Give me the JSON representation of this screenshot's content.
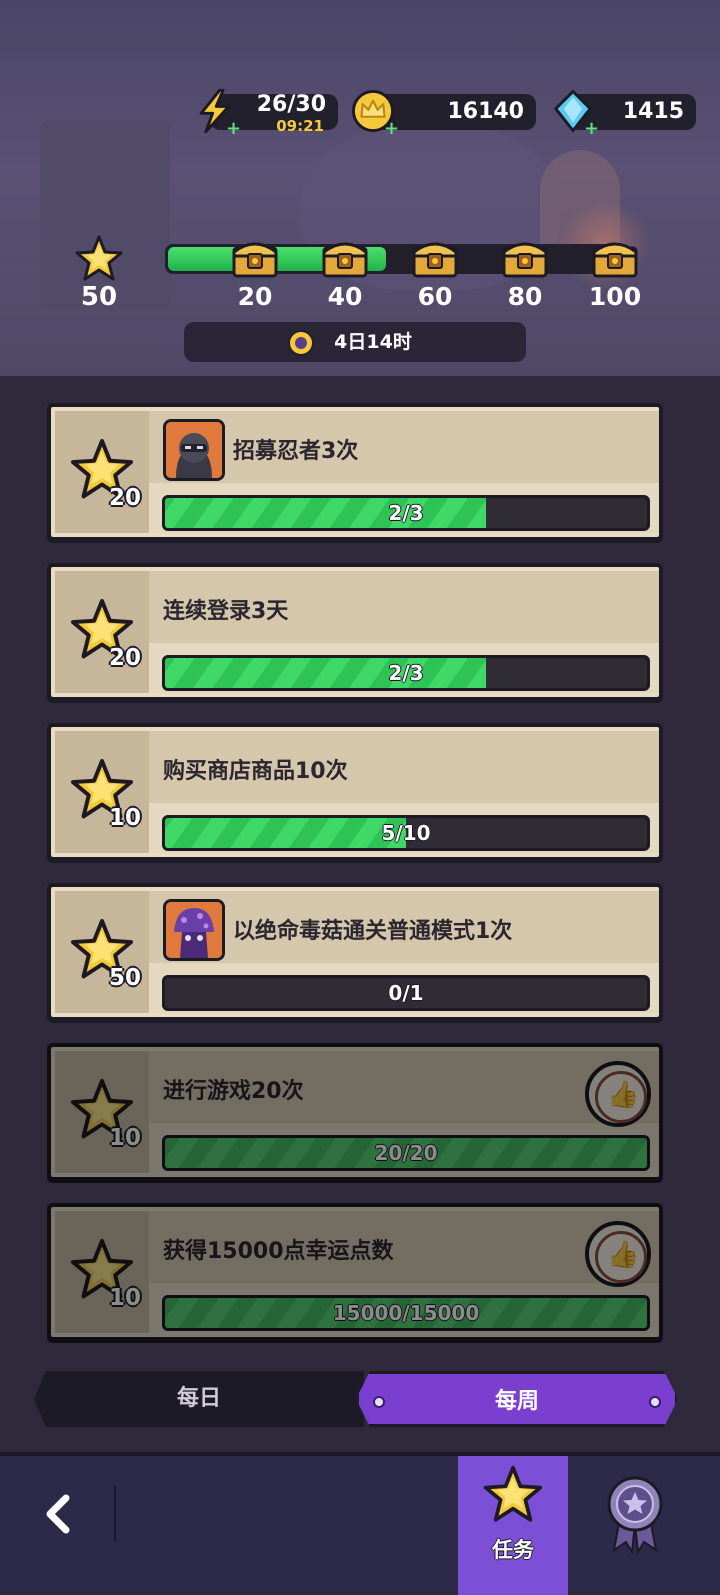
{
  "resources": {
    "energy": {
      "value": "26/30",
      "timer": "09:21"
    },
    "gold": {
      "value": "16140"
    },
    "gems": {
      "value": "1415"
    }
  },
  "progress": {
    "star_total": "50",
    "milestones": [
      "20",
      "40",
      "60",
      "80",
      "100"
    ],
    "fill_fraction": 0.49
  },
  "timer": {
    "label": "4日14时"
  },
  "tasks": [
    {
      "title": "招募忍者3次",
      "reward": "20",
      "progress": "2/3",
      "fraction": 0.667,
      "avatar": "ninja-avatar",
      "done": false
    },
    {
      "title": "连续登录3天",
      "reward": "20",
      "progress": "2/3",
      "fraction": 0.667,
      "avatar": "",
      "done": false
    },
    {
      "title": "购买商店商品10次",
      "reward": "10",
      "progress": "5/10",
      "fraction": 0.5,
      "avatar": "",
      "done": false
    },
    {
      "title": "以绝命毒菇通关普通模式1次",
      "reward": "50",
      "progress": "0/1",
      "fraction": 0,
      "avatar": "mushroom-avatar",
      "done": false
    },
    {
      "title": "进行游戏20次",
      "reward": "10",
      "progress": "20/20",
      "fraction": 1,
      "avatar": "",
      "done": true
    },
    {
      "title": "获得15000点幸运点数",
      "reward": "10",
      "progress": "15000/15000",
      "fraction": 1,
      "avatar": "",
      "done": true
    }
  ],
  "tabs": {
    "daily": "每日",
    "weekly": "每周",
    "active": "weekly"
  },
  "bottom_nav": {
    "task_label": "任务"
  },
  "colors": {
    "accent": "#7b3fd0",
    "bar_green": "#3fd866",
    "gold": "#f6c93a"
  },
  "icons": [
    "lightning-icon",
    "crown-coin-icon",
    "gem-icon",
    "star-icon",
    "chest-icon",
    "clock-icon",
    "thumbs-up-icon",
    "back-arrow-icon",
    "medal-icon"
  ]
}
